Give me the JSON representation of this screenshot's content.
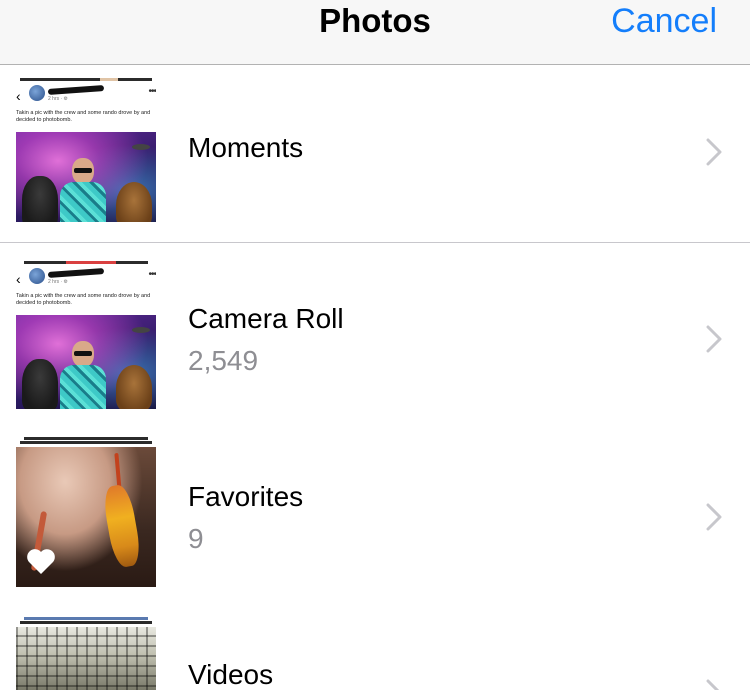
{
  "navbar": {
    "title": "Photos",
    "cancel_label": "Cancel"
  },
  "screenshot_post": {
    "time": "2 hrs · ⚙",
    "caption": "Takin a pic with the crew and some rando drove by and decided to photobomb."
  },
  "albums": [
    {
      "title": "Moments",
      "count": ""
    },
    {
      "title": "Camera Roll",
      "count": "2,549"
    },
    {
      "title": "Favorites",
      "count": "9"
    },
    {
      "title": "Videos",
      "count": ""
    }
  ],
  "icons": {
    "back": "back-chevron-icon",
    "more": "ellipsis-icon",
    "favorite": "heart-icon",
    "disclosure": "chevron-right-icon"
  },
  "colors": {
    "accent": "#147efb",
    "secondary_text": "#8e8e93",
    "separator": "#c8c7cc"
  }
}
